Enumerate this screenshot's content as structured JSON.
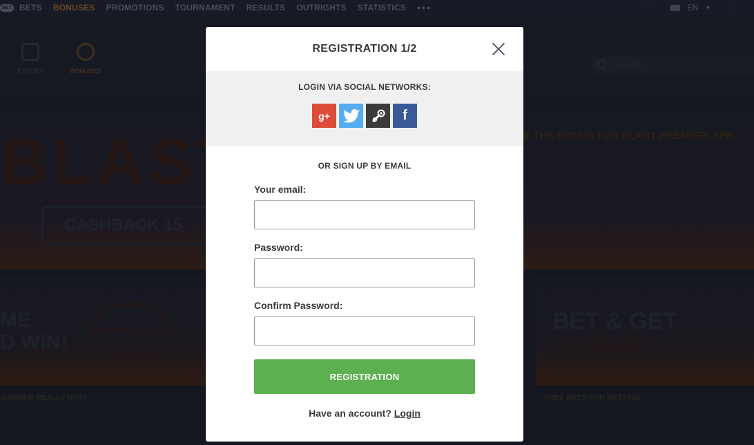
{
  "nav": {
    "logo_badge": "BET",
    "items": [
      "BETS",
      "BONUSES",
      "PROMOTIONS",
      "TOURNAMENT",
      "RESULTS",
      "OUTRIGHTS",
      "STATISTICS"
    ],
    "active_item": "BONUSES",
    "more": "•••",
    "language": "EN"
  },
  "subbar": {
    "tabs": [
      {
        "label": "ESPORT",
        "icon": "esport-icon"
      },
      {
        "label": "BONUSES",
        "icon": "bonus-icon"
      }
    ],
    "search_placeholder": "Search..."
  },
  "banner": {
    "big_text": "BLAST",
    "cashback": "CASHBACK 15",
    "ticker": "E THE BONUS FOR BLAST PREMIER: SPR"
  },
  "promos": {
    "left_text": "ME\nD WIN!",
    "left_badge": "SUMMER MASTERS",
    "right_text": "BET & GET",
    "right_sub": "A FREEBET",
    "left_caption": "SUMMER REALLY HOT!",
    "right_caption": "FREE BETS FOR BETTING"
  },
  "modal": {
    "title": "REGISTRATION 1/2",
    "social_label": "LOGIN VIA SOCIAL NETWORKS:",
    "social": [
      {
        "name": "google-plus",
        "glyph": "g+",
        "color": "#dd4b39"
      },
      {
        "name": "twitter",
        "color": "#55acee"
      },
      {
        "name": "steam",
        "color": "#3b3b3b"
      },
      {
        "name": "facebook",
        "glyph": "f",
        "color": "#3b5998"
      }
    ],
    "or_label": "OR SIGN UP BY EMAIL",
    "email_label": "Your email:",
    "email_value": "",
    "password_label": "Password:",
    "password_value": "",
    "confirm_label": "Confirm Password:",
    "confirm_value": "",
    "submit_label": "REGISTRATION",
    "have_account": "Have an account?",
    "login_link": "Login"
  },
  "colors": {
    "accent_green": "#5cb050",
    "nav_active": "#b9733a",
    "background": "#1c1f2b"
  }
}
